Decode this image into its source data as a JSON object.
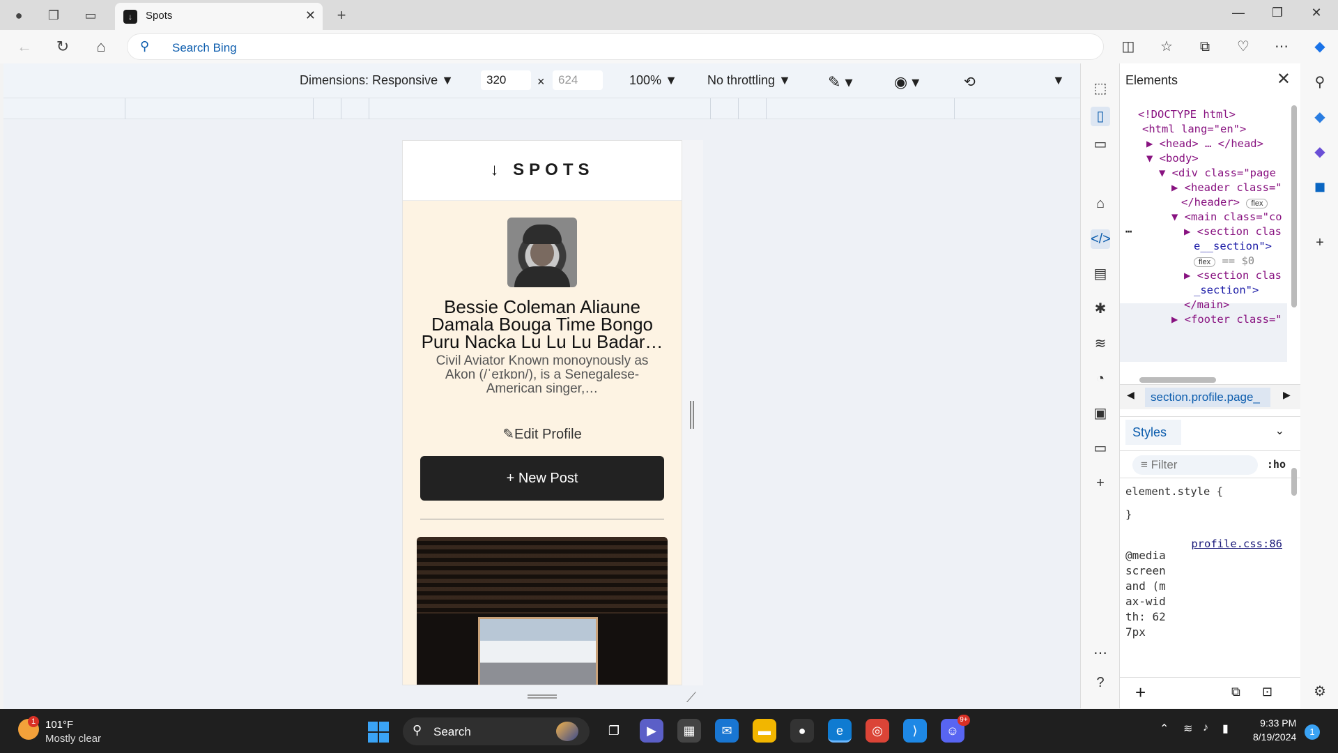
{
  "browser": {
    "tab_title": "Spots",
    "tab_favicon": "spots-favicon",
    "address_placeholder": "Search Bing",
    "new_tab_symbol": "+",
    "close_symbol": "✕"
  },
  "device_toolbar": {
    "dimensions_label": "Dimensions: Responsive",
    "width": "320",
    "times": "×",
    "height": "624",
    "zoom": "100%",
    "throttling": "No throttling"
  },
  "site": {
    "logo": "SPOTS",
    "profile_name": "Bessie Coleman Aliaune Damala Bouga Time Bongo Puru Nacka Lu Lu Lu Badar…",
    "profile_bio": "Civil Aviator Known monoynously as Akon (/ˈeɪkɒn/), is a Senegalese-American singer,…",
    "edit_profile": "Edit Profile",
    "new_post": "New Post"
  },
  "devtools": {
    "panel_title": "Elements",
    "dom_lines": [
      {
        "indent": 0,
        "text": "<!DOCTYPE html>"
      },
      {
        "indent": 1,
        "text": "<html lang=\"en\">"
      },
      {
        "indent": 2,
        "text": "▶ <head> … </head>"
      },
      {
        "indent": 2,
        "text": "▼ <body>"
      },
      {
        "indent": 3,
        "text": "▼ <div class=\"page"
      },
      {
        "indent": 4,
        "text": "▶ <header class=\""
      },
      {
        "indent": 5,
        "text": "</header>"
      },
      {
        "indent": 4,
        "text": "▼ <main class=\"co"
      },
      {
        "indent": 5,
        "text": "▶ <section clas"
      },
      {
        "indent": 6,
        "text": "e__section\">"
      },
      {
        "indent": 6,
        "text": "== $0"
      },
      {
        "indent": 5,
        "text": "▶ <section clas"
      },
      {
        "indent": 6,
        "text": "_section\">"
      },
      {
        "indent": 5,
        "text": "</main>"
      },
      {
        "indent": 4,
        "text": "▶ <footer class=\""
      }
    ],
    "badge_flex": "flex",
    "breadcrumb": "section.profile.page_",
    "styles_tab": "Styles",
    "filter_placeholder": "Filter",
    "hov_label": ":ho",
    "element_style_open": "element.style {",
    "element_style_close": "}",
    "css_source": "profile.css:86",
    "media_query": "@media screen and (max-width: 627px"
  },
  "taskbar": {
    "weather_temp": "101°F",
    "weather_desc": "Mostly clear",
    "weather_badge": "1",
    "search_label": "Search",
    "time": "9:33 PM",
    "date": "8/19/2024",
    "notification_count": "1",
    "discord_badge": "9+"
  },
  "colors": {
    "accent": "#0b5cad",
    "page_bg": "#fdf3e3",
    "button_dark": "#222222",
    "taskbar": "#1f1f1f"
  }
}
